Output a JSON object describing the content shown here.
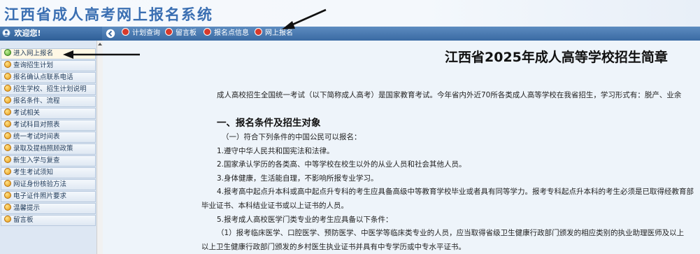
{
  "banner": {
    "title": "江西省成人高考网上报名系统"
  },
  "left_header": {
    "label": "欢迎您!"
  },
  "topnav": {
    "items": [
      {
        "label": "计划查询"
      },
      {
        "label": "留言板"
      },
      {
        "label": "报名点信息"
      },
      {
        "label": "网上报名"
      }
    ]
  },
  "sidebar": {
    "items": [
      {
        "label": "进入网上报名",
        "active": true
      },
      {
        "label": "查询招生计划"
      },
      {
        "label": "报名确认点联系电话"
      },
      {
        "label": "招生学校、招生计划说明"
      },
      {
        "label": "报名条件、流程"
      },
      {
        "label": "考试相关"
      },
      {
        "label": "考试科目对照表"
      },
      {
        "label": "统一考试时间表"
      },
      {
        "label": "录取及提档照顾政策"
      },
      {
        "label": "新生入学与复查"
      },
      {
        "label": "考生考试须知"
      },
      {
        "label": "网证身份核验方法"
      },
      {
        "label": "电子证件照片要求"
      },
      {
        "label": "温馨提示"
      },
      {
        "label": "留言板"
      }
    ]
  },
  "main": {
    "title": "江西省2025年成人高等学校招生简章",
    "intro": "成人高校招生全国统一考试（以下简称成人高考）是国家教育考试。今年省内外近70所各类成人高等学校在我省招生，学习形式有：脱产、业余",
    "section1_heading": "一、报名条件及招生对象",
    "lines": [
      "（一）符合下列条件的中国公民可以报名：",
      "1.遵守中华人民共和国宪法和法律。",
      "2.国家承认学历的各类高、中等学校在校生以外的从业人员和社会其他人员。",
      "3.身体健康，生活能自理，不影响所报专业学习。",
      "4.报考高中起点升本科或高中起点升专科的考生应具备高级中等教育学校毕业或者具有同等学力。报考专科起点升本科的考生必须是已取得经教育部",
      "毕业证书、本科结业证书或以上证书的人员。",
      "5.报考成人高校医学门类专业的考生应具备以下条件：",
      "（1）报考临床医学、口腔医学、预防医学、中医学等临床类专业的人员，应当取得省级卫生健康行政部门颁发的相应类别的执业助理医师及以上",
      "以上卫生健康行政部门颁发的乡村医生执业证书并具有中专学历或中专水平证书。"
    ]
  },
  "colors": {
    "banner_text": "#3b6fb2",
    "nav_bg": "#3a6aa3",
    "sidebar_bg": "#dde7f3",
    "main_bg": "#eef4fa",
    "nav_dot": "#d83a2b"
  },
  "icons": {
    "collapse": "circle-arrow-left-icon",
    "nav_item": "red-dot-icon",
    "sidebar_bullet": "orange-bullet-icon",
    "sidebar_active_bullet": "green-bullet-icon",
    "annotation": "arrow-annotation-icon"
  }
}
